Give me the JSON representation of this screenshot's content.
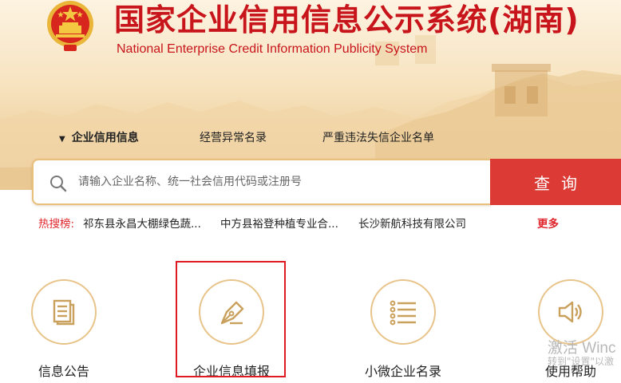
{
  "header": {
    "title": "国家企业信用信息公示系统(湖南)",
    "subtitle": "National Enterprise Credit Information Publicity System"
  },
  "colors": {
    "brand_red": "#c8141b",
    "search_button": "#dc3b35",
    "hot_label": "#e0262d",
    "feature_ring": "#e8c48a",
    "highlight_box": "#e01a22"
  },
  "tabs": [
    {
      "label": "企业信用信息",
      "active": true
    },
    {
      "label": "经营异常名录",
      "active": false
    },
    {
      "label": "严重违法失信企业名单",
      "active": false
    }
  ],
  "search": {
    "placeholder": "请输入企业名称、统一社会信用代码或注册号",
    "value": "",
    "button_label": "查询"
  },
  "hot_search": {
    "label": "热搜榜:",
    "items": [
      "祁东县永昌大棚绿色蔬...",
      "中方县裕登种植专业合...",
      "长沙新航科技有限公司"
    ],
    "more_label": "更多"
  },
  "features": [
    {
      "label": "信息公告",
      "icon": "document-icon"
    },
    {
      "label": "企业信息填报",
      "icon": "pen-nib-icon"
    },
    {
      "label": "小微企业名录",
      "icon": "list-icon"
    },
    {
      "label": "使用帮助",
      "icon": "speaker-icon"
    }
  ],
  "watermark": {
    "line1": "激活 Winc",
    "line2": "转到\"设置\"以激"
  }
}
